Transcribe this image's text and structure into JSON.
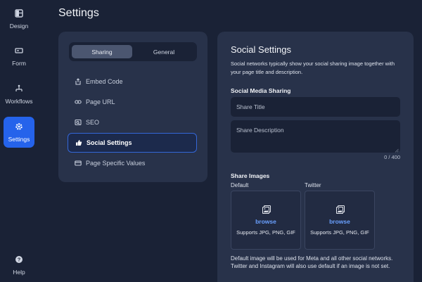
{
  "page": {
    "title": "Settings"
  },
  "rail": {
    "items": [
      {
        "label": "Design",
        "icon": "layout-icon"
      },
      {
        "label": "Form",
        "icon": "form-icon"
      },
      {
        "label": "Workflows",
        "icon": "workflow-icon"
      },
      {
        "label": "Settings",
        "icon": "gear-icon",
        "active": true
      }
    ],
    "help": {
      "label": "Help",
      "icon": "help-icon"
    }
  },
  "tabs": {
    "items": [
      {
        "label": "Sharing",
        "active": true
      },
      {
        "label": "General"
      }
    ]
  },
  "nav": {
    "items": [
      {
        "label": "Embed Code",
        "icon": "embed-icon"
      },
      {
        "label": "Page URL",
        "icon": "link-icon"
      },
      {
        "label": "SEO",
        "icon": "seo-icon"
      },
      {
        "label": "Social Settings",
        "icon": "thumbs-up-icon",
        "active": true
      },
      {
        "label": "Page Specific Values",
        "icon": "card-icon"
      }
    ]
  },
  "social": {
    "title": "Social Settings",
    "description": "Social networks typically show your social sharing image together with your page title and description.",
    "media_heading": "Social Media Sharing",
    "share_title_placeholder": "Share Title",
    "share_description_placeholder": "Share Description",
    "char_count": "0 / 400",
    "images_heading": "Share Images",
    "default_label": "Default",
    "twitter_label": "Twitter",
    "browse_label": "browse",
    "supports_text": "Supports JPG, PNG, GIF",
    "footnote": "Default image will be used for Meta and all other social networks. Twitter and Instagram will also use default if an image is not set."
  },
  "colors": {
    "background": "#1a2236",
    "card": "#28324a",
    "accent": "#2563eb",
    "link": "#6aa0ff"
  }
}
